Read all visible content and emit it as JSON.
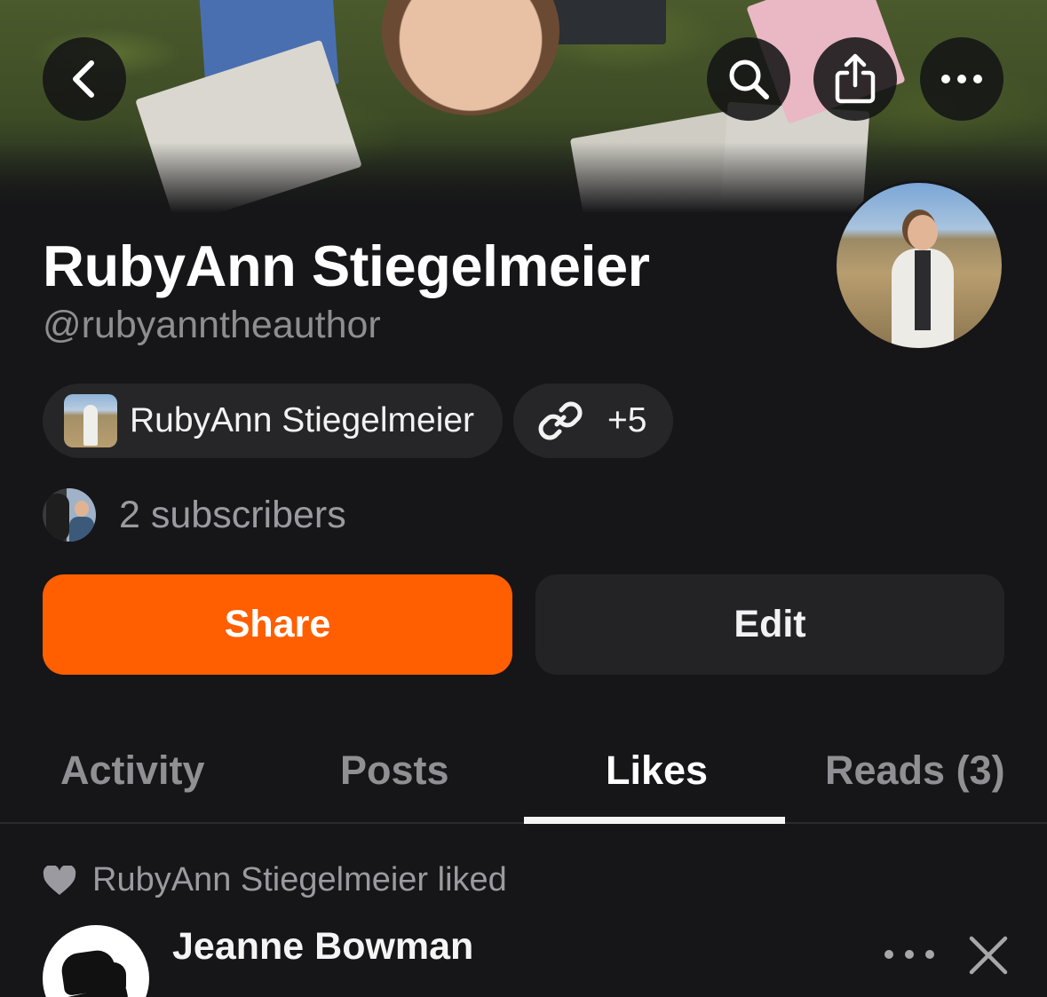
{
  "header": {
    "back_label": "Back",
    "search_label": "Search",
    "share_icon_label": "Share",
    "more_label": "More"
  },
  "profile": {
    "name": "RubyAnn Stiegelmeier",
    "handle": "@rubyanntheauthor",
    "publication_pill": "RubyAnn Stiegelmeier",
    "links_count": "+5",
    "subscribers": "2 subscribers"
  },
  "actions": {
    "share_label": "Share",
    "edit_label": "Edit"
  },
  "tabs": [
    {
      "label": "Activity",
      "active": false
    },
    {
      "label": "Posts",
      "active": false
    },
    {
      "label": "Likes",
      "active": true
    },
    {
      "label": "Reads (3)",
      "active": false
    }
  ],
  "feed": {
    "liked_text": "RubyAnn Stiegelmeier liked",
    "item_author": "Jeanne Bowman"
  },
  "colors": {
    "accent": "#ff5f00",
    "background": "#161618",
    "muted_text": "#8d8d92"
  },
  "icons": [
    "chevron-left-icon",
    "search-icon",
    "share-upload-icon",
    "more-horizontal-icon",
    "link-icon",
    "heart-icon",
    "close-icon"
  ]
}
